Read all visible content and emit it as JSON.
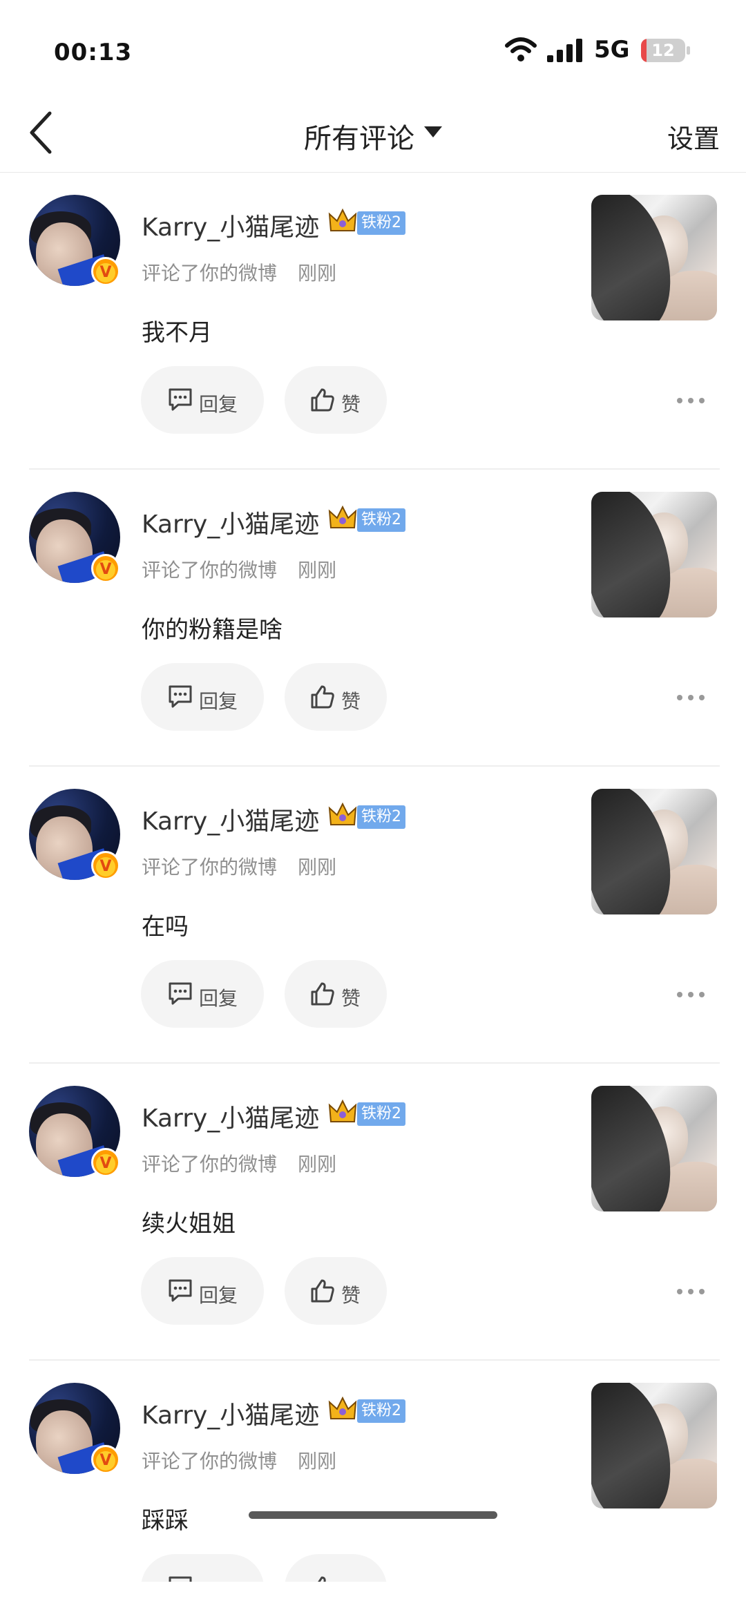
{
  "status_bar": {
    "time": "00:13",
    "network": "5G",
    "battery": "12",
    "battery_level": 0.12
  },
  "nav": {
    "title": "所有评论",
    "settings_label": "设置"
  },
  "colors": {
    "fan_badge": "#71a9ec",
    "verified": "#ff9c00",
    "battery_low": "#e84a4a"
  },
  "comments": [
    {
      "username": "Karry_小猫尾迹",
      "fan_badge": "铁粉2",
      "action": "评论了你的微博",
      "time": "刚刚",
      "text": "我不月",
      "reply_label": "回复",
      "like_label": "赞"
    },
    {
      "username": "Karry_小猫尾迹",
      "fan_badge": "铁粉2",
      "action": "评论了你的微博",
      "time": "刚刚",
      "text": "你的粉籍是啥",
      "reply_label": "回复",
      "like_label": "赞"
    },
    {
      "username": "Karry_小猫尾迹",
      "fan_badge": "铁粉2",
      "action": "评论了你的微博",
      "time": "刚刚",
      "text": "在吗",
      "reply_label": "回复",
      "like_label": "赞"
    },
    {
      "username": "Karry_小猫尾迹",
      "fan_badge": "铁粉2",
      "action": "评论了你的微博",
      "time": "刚刚",
      "text": "续火姐姐",
      "reply_label": "回复",
      "like_label": "赞"
    },
    {
      "username": "Karry_小猫尾迹",
      "fan_badge": "铁粉2",
      "action": "评论了你的微博",
      "time": "刚刚",
      "text": "踩踩",
      "reply_label": "回复",
      "like_label": "赞"
    }
  ]
}
